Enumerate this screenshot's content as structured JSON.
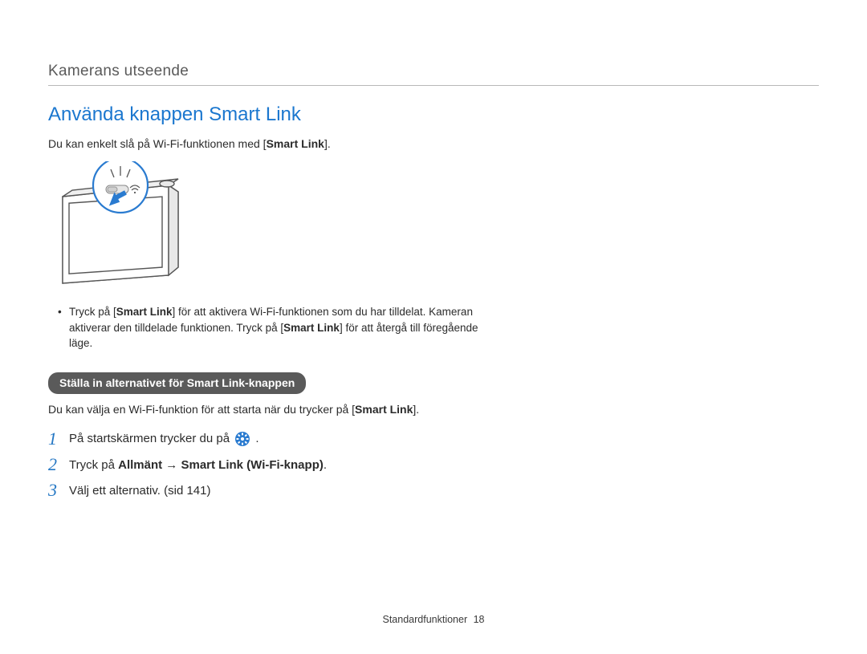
{
  "header": {
    "section": "Kamerans utseende"
  },
  "title": "Använda knappen Smart Link",
  "intro": {
    "before": "Du kan enkelt slå på Wi-Fi-funktionen med [",
    "bold": "Smart Link",
    "after": "]."
  },
  "bullet": {
    "p1a": "Tryck på [",
    "p1b": "Smart Link",
    "p1c": "] för att aktivera Wi-Fi-funktionen som du har tilldelat. Kameran aktiverar den tilldelade funktionen. Tryck på [",
    "p1d": "Smart Link",
    "p1e": "] för att återgå till föregående läge."
  },
  "pill": "Ställa in alternativet för Smart Link-knappen",
  "subintro": {
    "a": "Du kan välja en Wi-Fi-funktion för att starta när du trycker på [",
    "b": "Smart Link",
    "c": "]."
  },
  "steps": {
    "s1": {
      "num": "1",
      "text": "På startskärmen trycker du på ",
      "after": "."
    },
    "s2": {
      "num": "2",
      "a": "Tryck på ",
      "b": "Allmänt",
      "arrow": " → ",
      "c": "Smart Link (Wi-Fi-knapp)",
      "d": "."
    },
    "s3": {
      "num": "3",
      "text": "Välj ett alternativ. (sid 141)"
    }
  },
  "footer": {
    "label": "Standardfunktioner",
    "page": "18"
  }
}
